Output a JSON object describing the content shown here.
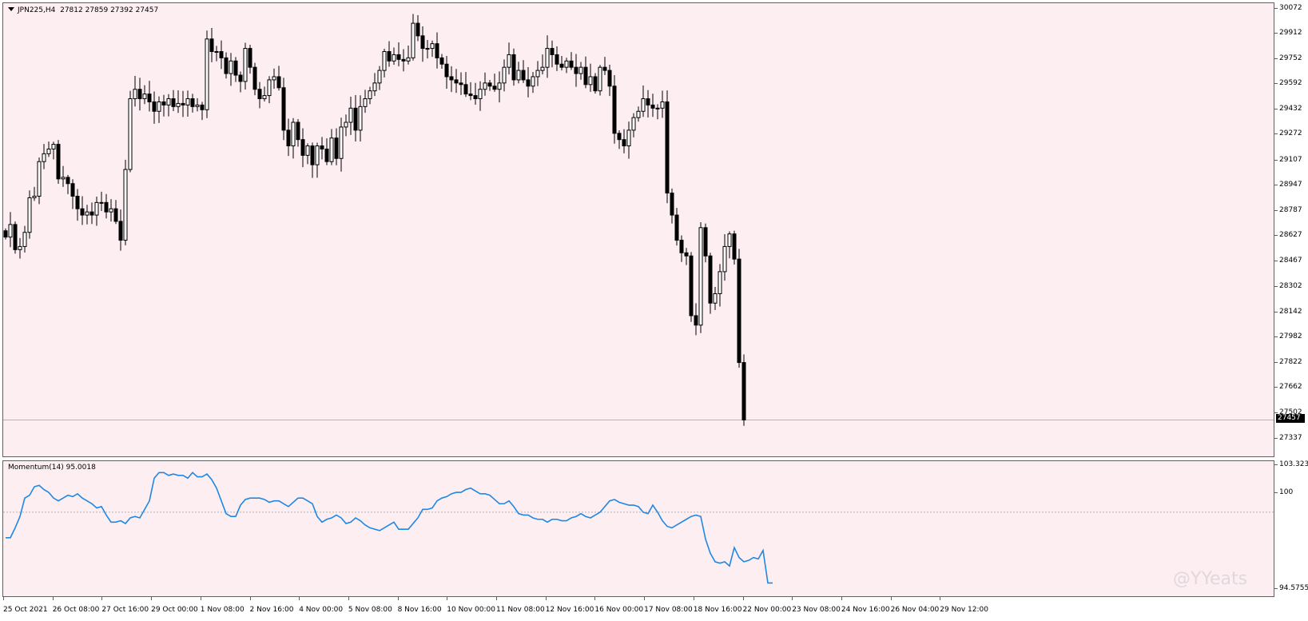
{
  "chart_header": {
    "symbol_timeframe": "JPN225,H4",
    "ohlc": "27812 27859 27392 27457"
  },
  "indicator": {
    "label": "Momentum(14) 95.0018",
    "level_100_label": "100"
  },
  "price_axis": {
    "ticks": [
      "30072",
      "29912",
      "29752",
      "29592",
      "29432",
      "29272",
      "29107",
      "28947",
      "28787",
      "28627",
      "28467",
      "28302",
      "28142",
      "27982",
      "27822",
      "27662",
      "27502",
      "27337"
    ],
    "current_price": "27457"
  },
  "indicator_axis": {
    "top": "103.3238",
    "mid": "100",
    "bottom": "94.5755"
  },
  "time_axis": {
    "labels": [
      "25 Oct 2021",
      "26 Oct 08:00",
      "27 Oct 16:00",
      "29 Oct 00:00",
      "1 Nov 08:00",
      "2 Nov 16:00",
      "4 Nov 00:00",
      "5 Nov 08:00",
      "8 Nov 16:00",
      "10 Nov 00:00",
      "11 Nov 08:00",
      "12 Nov 16:00",
      "16 Nov 00:00",
      "17 Nov 08:00",
      "18 Nov 16:00",
      "22 Nov 00:00",
      "23 Nov 08:00",
      "24 Nov 16:00",
      "26 Nov 04:00",
      "29 Nov 12:00"
    ]
  },
  "watermark": "@YYeats",
  "colors": {
    "background": "#fdeef2",
    "candle_bull_body": "#ffffff",
    "candle_bear_body": "#000000",
    "momentum_line": "#1e88e5",
    "price_line": "#a0a0a0"
  },
  "chart_data": {
    "type": "candlestick",
    "symbol": "JPN225",
    "timeframe": "H4",
    "ylim": [
      27337,
      30072
    ],
    "current_price": 27457,
    "closes": [
      28620,
      28700,
      28540,
      28560,
      28650,
      28870,
      28880,
      29100,
      29150,
      29180,
      29210,
      28990,
      29000,
      28960,
      28880,
      28800,
      28760,
      28780,
      28760,
      28840,
      28840,
      28780,
      28800,
      28720,
      28600,
      29050,
      29500,
      29560,
      29500,
      29530,
      29480,
      29420,
      29480,
      29460,
      29500,
      29450,
      29470,
      29460,
      29500,
      29450,
      29460,
      29430,
      29880,
      29800,
      29800,
      29760,
      29660,
      29740,
      29650,
      29610,
      29820,
      29700,
      29560,
      29500,
      29520,
      29620,
      29640,
      29570,
      29300,
      29200,
      29350,
      29240,
      29140,
      29200,
      29080,
      29200,
      29180,
      29100,
      29250,
      29120,
      29320,
      29350,
      29440,
      29300,
      29450,
      29500,
      29550,
      29600,
      29680,
      29800,
      29740,
      29780,
      29750,
      29740,
      29760,
      29980,
      29900,
      29820,
      29820,
      29850,
      29760,
      29720,
      29640,
      29620,
      29600,
      29590,
      29530,
      29520,
      29500,
      29560,
      29600,
      29580,
      29560,
      29600,
      29700,
      29780,
      29620,
      29680,
      29620,
      29580,
      29640,
      29680,
      29700,
      29820,
      29780,
      29720,
      29700,
      29740,
      29700,
      29660,
      29700,
      29590,
      29640,
      29550,
      29700,
      29680,
      29580,
      29280,
      29240,
      29200,
      29300,
      29380,
      29420,
      29500,
      29460,
      29440,
      29440,
      29480,
      28900,
      28760,
      28600,
      28520,
      28500,
      28120,
      28060,
      28680,
      28500,
      28200,
      28260,
      28400,
      28560,
      28640,
      28480,
      27822,
      27457
    ],
    "momentum": {
      "name": "Momentum(14)",
      "last": 95.0018,
      "level": 100,
      "ylim": [
        94.5755,
        103.3238
      ],
      "values": [
        98.2,
        98.2,
        98.9,
        99.7,
        101.0,
        101.2,
        101.8,
        101.9,
        101.6,
        101.4,
        101.0,
        100.8,
        101.0,
        101.2,
        101.1,
        101.3,
        101.0,
        100.8,
        100.6,
        100.3,
        100.4,
        99.8,
        99.3,
        99.3,
        99.4,
        99.2,
        99.6,
        99.7,
        99.6,
        100.2,
        100.8,
        102.4,
        102.8,
        102.8,
        102.6,
        102.7,
        102.6,
        102.6,
        102.4,
        102.8,
        102.5,
        102.5,
        102.7,
        102.3,
        101.7,
        100.8,
        99.9,
        99.7,
        99.7,
        100.5,
        100.9,
        101.0,
        101.0,
        101.0,
        100.9,
        100.7,
        100.8,
        100.8,
        100.6,
        100.4,
        100.7,
        101.0,
        101.0,
        100.8,
        100.6,
        99.7,
        99.3,
        99.5,
        99.6,
        99.8,
        99.6,
        99.2,
        99.3,
        99.6,
        99.4,
        99.1,
        98.9,
        98.8,
        98.7,
        98.9,
        99.1,
        99.3,
        98.8,
        98.8,
        98.8,
        99.2,
        99.6,
        100.2,
        100.2,
        100.3,
        100.8,
        101.0,
        101.1,
        101.3,
        101.4,
        101.4,
        101.6,
        101.7,
        101.5,
        101.3,
        101.3,
        101.2,
        100.9,
        100.6,
        100.6,
        100.8,
        100.4,
        99.9,
        99.8,
        99.8,
        99.6,
        99.5,
        99.5,
        99.3,
        99.5,
        99.5,
        99.4,
        99.4,
        99.6,
        99.7,
        99.9,
        99.7,
        99.6,
        99.8,
        100.0,
        100.4,
        100.8,
        100.9,
        100.7,
        100.6,
        100.5,
        100.5,
        100.4,
        100.0,
        99.9,
        100.5,
        100.0,
        99.4,
        99.0,
        98.9,
        99.1,
        99.3,
        99.5,
        99.7,
        99.8,
        99.7,
        98.1,
        97.1,
        96.5,
        96.4,
        96.5,
        96.2,
        97.5,
        96.8,
        96.5,
        96.6,
        96.8,
        96.7,
        97.3,
        95.0,
        95.0
      ]
    }
  }
}
